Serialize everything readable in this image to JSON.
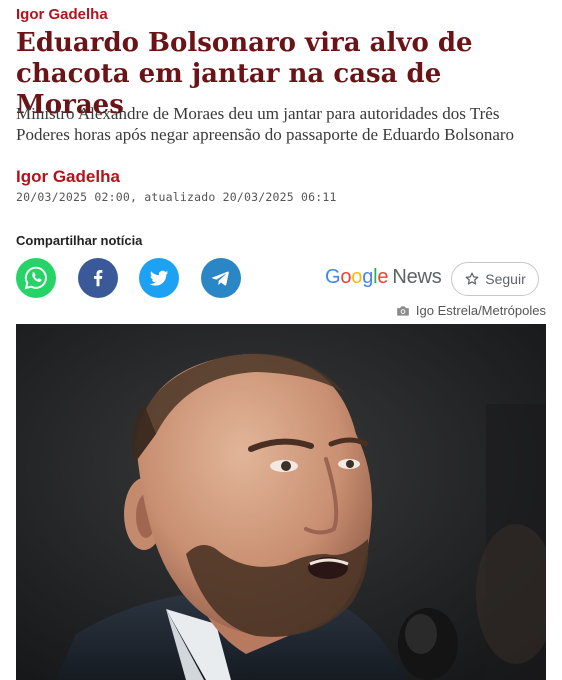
{
  "article": {
    "kicker": "Igor Gadelha",
    "headline": "Eduardo Bolsonaro vira alvo de chacota em jantar na casa de Moraes",
    "subtitle": "Ministro Alexandre de Moraes deu um jantar para autoridades dos Três Poderes horas após negar apreensão do passaporte de Eduardo Bolsonaro",
    "author": "Igor Gadelha",
    "dates": "20/03/2025 02:00, atualizado 20/03/2025 06:11"
  },
  "share": {
    "title": "Compartilhar notícia",
    "buttons": [
      {
        "icon": "whatsapp-icon",
        "color": "#25d366"
      },
      {
        "icon": "facebook-icon",
        "color": "#3b5998"
      },
      {
        "icon": "twitter-icon",
        "color": "#1da1f2"
      },
      {
        "icon": "telegram-icon",
        "color": "#2b86c5"
      }
    ]
  },
  "google_news": {
    "google_letters": [
      "G",
      "o",
      "o",
      "g",
      "l",
      "e"
    ],
    "google_colors": [
      "#4285f4",
      "#ea4335",
      "#fbbc05",
      "#4285f4",
      "#34a853",
      "#ea4335"
    ],
    "news_label": "News",
    "follow_label": "Seguir"
  },
  "photo": {
    "credit": "Igo Estrela/Metrópoles",
    "icon": "camera-icon"
  },
  "colors": {
    "brand_red": "#b3131b",
    "headline": "#6b1418"
  }
}
